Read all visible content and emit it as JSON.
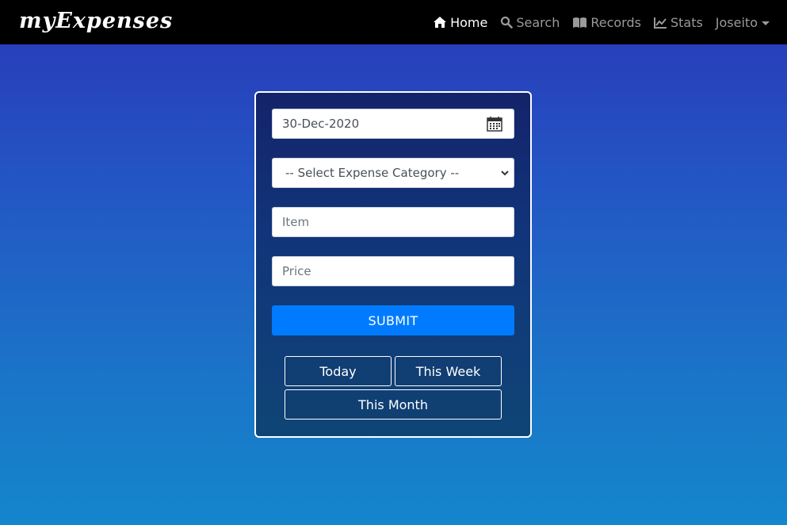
{
  "navbar": {
    "brand": "myExpenses",
    "items": [
      {
        "label": "Home",
        "icon": "home-icon",
        "active": true
      },
      {
        "label": "Search",
        "icon": "search-icon",
        "active": false
      },
      {
        "label": "Records",
        "icon": "book-icon",
        "active": false
      },
      {
        "label": "Stats",
        "icon": "chart-icon",
        "active": false
      }
    ],
    "user": "Joseito"
  },
  "form": {
    "date_value": "30-Dec-2020",
    "category_selected": "-- Select Expense Category --",
    "item_placeholder": "Item",
    "price_placeholder": "Price",
    "submit_label": "SUBMIT"
  },
  "filters": {
    "today": "Today",
    "this_week": "This Week",
    "this_month": "This Month"
  },
  "colors": {
    "navbar_bg": "#000000",
    "submit_bg": "#007bff",
    "card_border": "#ffffff"
  }
}
